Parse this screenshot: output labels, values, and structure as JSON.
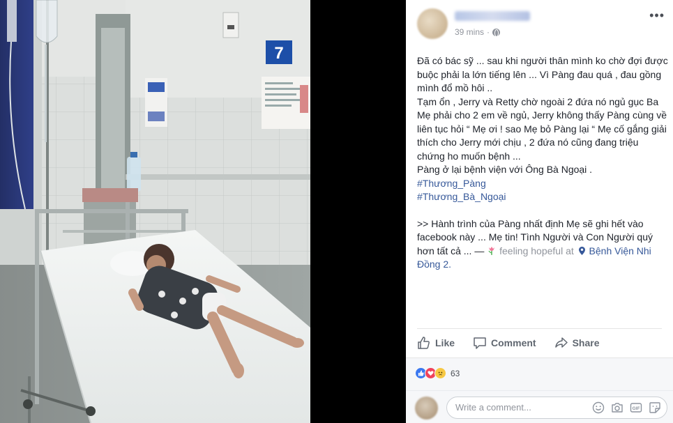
{
  "post": {
    "time": "39 mins",
    "text": {
      "p1": "Đã có bác sỹ ... sau khi người thân mình ko chờ đợi được buộc phải la lớn tiếng lên ... Vì Pàng đau quá , đau gồng mình đổ mồ hôi ..",
      "p2": "Tạm ổn , Jerry và Retty chờ ngoài 2 đứa nó ngủ gục Ba Mẹ phải cho 2 em về ngủ, Jerry không thấy Pàng cùng về liên tục hỏi “ Mẹ ơi ! sao Mẹ bỏ Pàng lại “ Mẹ cố gắng giải thích cho Jerry mới chịu , 2 đứa nó cũng đang triệu chứng ho muốn bệnh ...",
      "p3": "Pàng ở lại bệnh viện với Ông Bà Ngoại .",
      "hashtag1": "#Thương_Pàng",
      "hashtag2": "#Thương_Bà_Ngoại",
      "p4": ">> Hành trình của Pàng nhất định Mẹ sẽ ghi hết vào facebook này ... Mẹ tin! Tình Người và Con Người quý hơn tất cả ... —",
      "feeling": "feeling hopeful at",
      "place": "Bệnh Viện Nhi Đồng 2."
    }
  },
  "photo": {
    "room_number": "7"
  },
  "actions": {
    "like": "Like",
    "comment": "Comment",
    "share": "Share"
  },
  "reactions": {
    "count": "63"
  },
  "comment_box": {
    "placeholder": "Write a comment..."
  },
  "colors": {
    "link": "#365899",
    "text": "#1d2129",
    "muted": "#90949c",
    "like": "#3b78f0",
    "love": "#f0425b",
    "sad": "#f7c843"
  }
}
